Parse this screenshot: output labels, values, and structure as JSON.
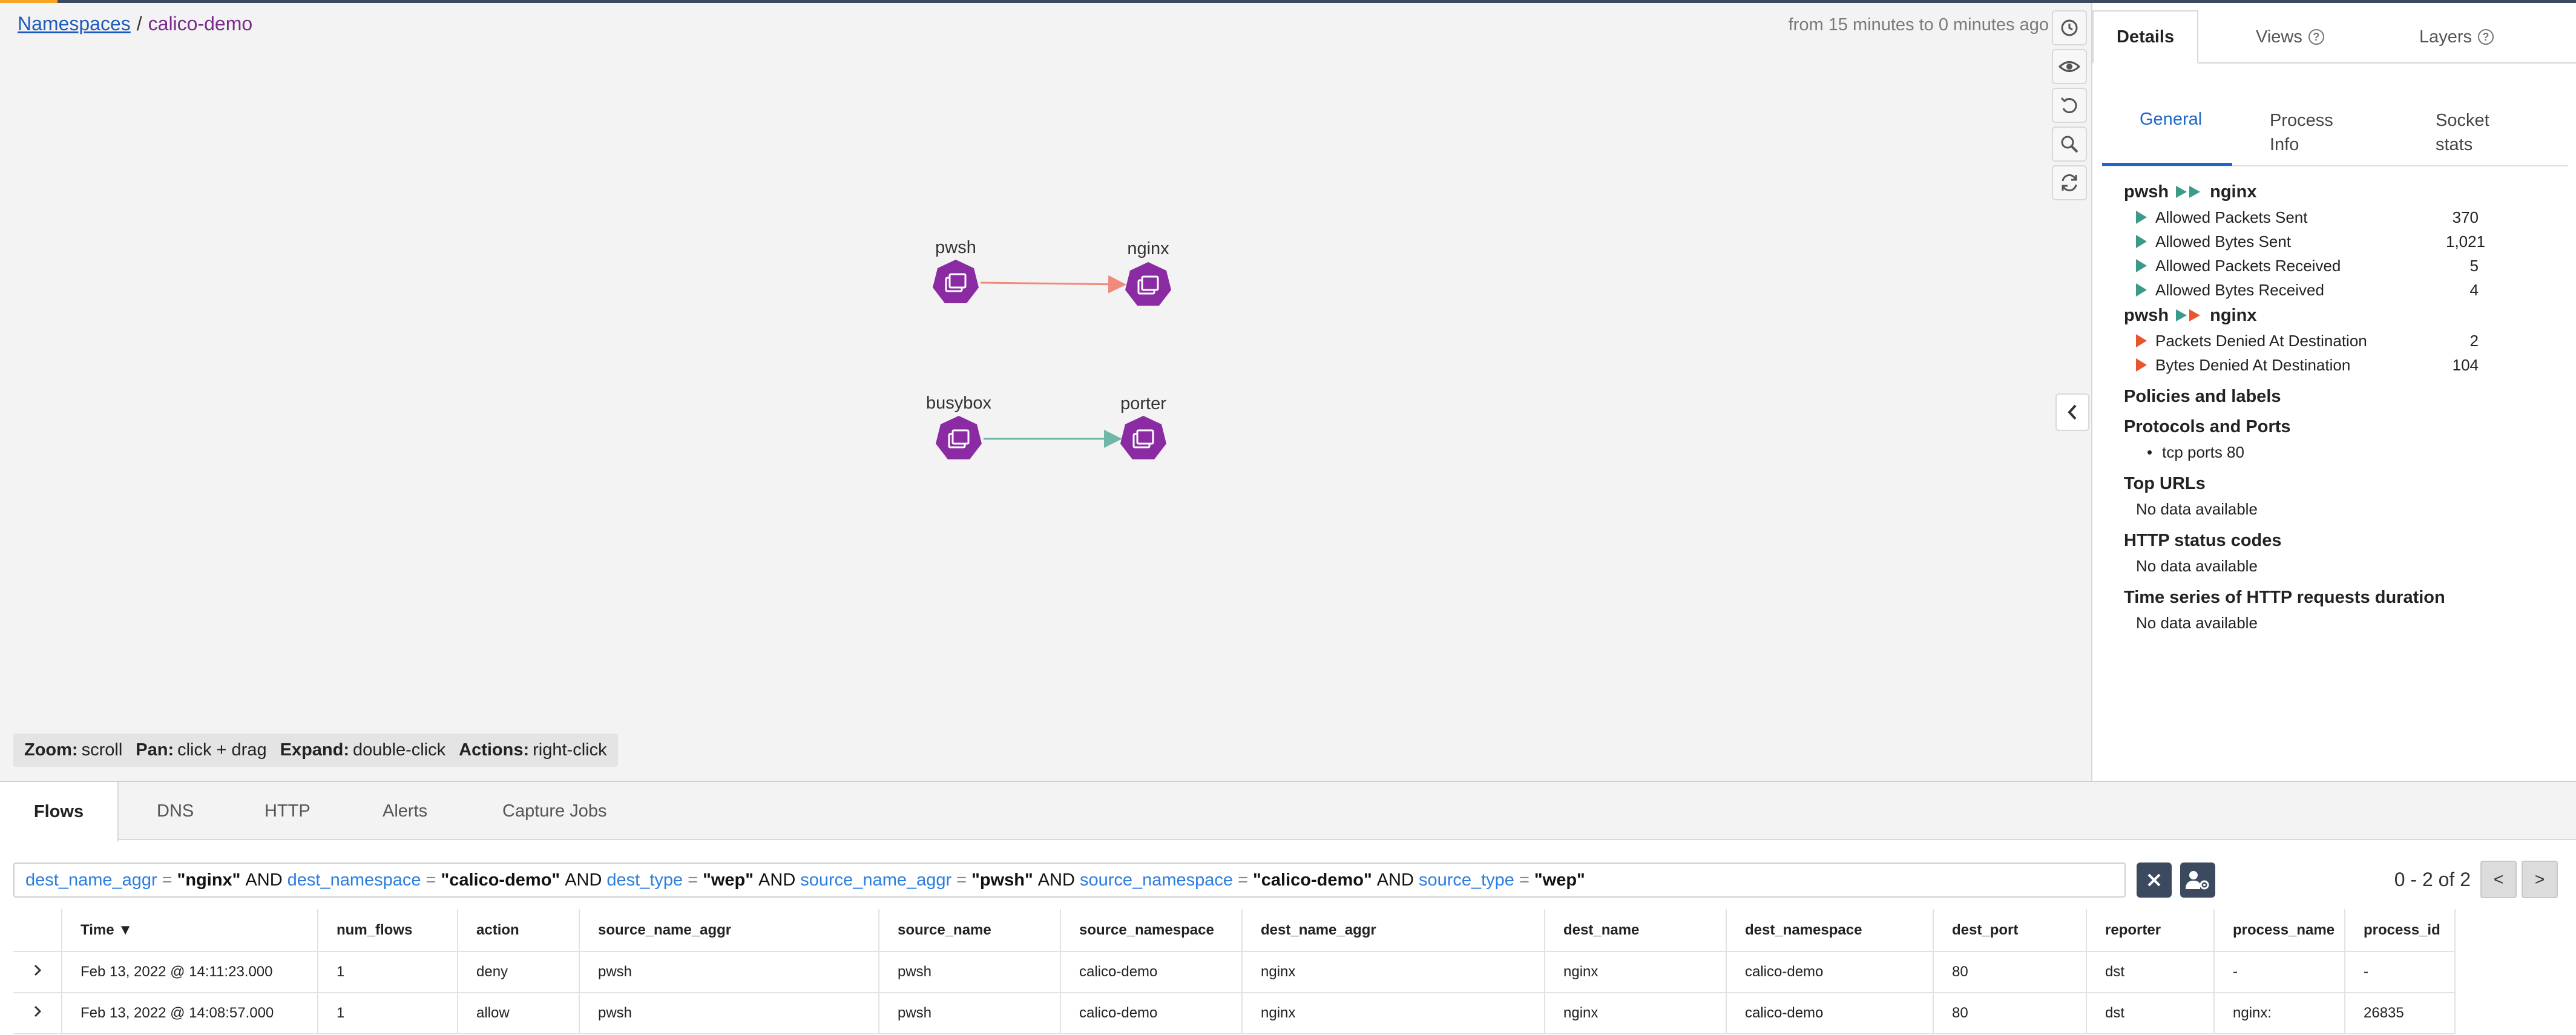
{
  "breadcrumb": {
    "root": "Namespaces",
    "separator": "/",
    "current": "calico-demo"
  },
  "time_range": "from 15 minutes to 0 minutes ago",
  "graph": {
    "nodes": [
      {
        "id": "pwsh",
        "label": "pwsh"
      },
      {
        "id": "nginx",
        "label": "nginx"
      },
      {
        "id": "busybox",
        "label": "busybox"
      },
      {
        "id": "porter",
        "label": "porter"
      }
    ],
    "edges": [
      {
        "from": "pwsh",
        "to": "nginx",
        "color": "#f08b7b"
      },
      {
        "from": "busybox",
        "to": "porter",
        "color": "#6fb8a8"
      }
    ],
    "node_color": "#8a2ba3"
  },
  "hints": [
    {
      "key": "Zoom:",
      "value": "scroll"
    },
    {
      "key": "Pan:",
      "value": "click + drag"
    },
    {
      "key": "Expand:",
      "value": "double-click"
    },
    {
      "key": "Actions:",
      "value": "right-click"
    }
  ],
  "right_panel": {
    "tabs": {
      "details": "Details",
      "views": "Views",
      "layers": "Layers"
    },
    "subtabs": {
      "general": "General",
      "process_info_1": "Process",
      "process_info_2": "Info",
      "socket_stats_1": "Socket",
      "socket_stats_2": "stats"
    },
    "allowed": {
      "source": "pwsh",
      "dest": "nginx",
      "stats": [
        {
          "name": "Allowed Packets Sent",
          "value": "370"
        },
        {
          "name": "Allowed Bytes Sent",
          "value": "1,021"
        },
        {
          "name": "Allowed Packets Received",
          "value": "5"
        },
        {
          "name": "Allowed Bytes Received",
          "value": "4"
        }
      ]
    },
    "denied": {
      "source": "pwsh",
      "dest": "nginx",
      "stats": [
        {
          "name": "Packets Denied At Destination",
          "value": "2"
        },
        {
          "name": "Bytes Denied At Destination",
          "value": "104"
        }
      ]
    },
    "policies_title": "Policies and labels",
    "protocols_title": "Protocols and Ports",
    "protocols_item": "tcp ports 80",
    "top_urls_title": "Top URLs",
    "http_codes_title": "HTTP status codes",
    "http_duration_title": "Time series of HTTP requests duration",
    "no_data": "No data available",
    "colors": {
      "allowed": "#3a9b8b",
      "denied": "#e8542e"
    }
  },
  "bottom_tabs": {
    "flows": "Flows",
    "dns": "DNS",
    "http": "HTTP",
    "alerts": "Alerts",
    "capture": "Capture Jobs"
  },
  "query": {
    "clauses": [
      {
        "field": "dest_name_aggr",
        "op": "=",
        "value": "\"nginx\""
      },
      {
        "field": "dest_namespace",
        "op": "=",
        "value": "\"calico-demo\""
      },
      {
        "field": "dest_type",
        "op": "=",
        "value": "\"wep\""
      },
      {
        "field": "source_name_aggr",
        "op": "=",
        "value": "\"pwsh\""
      },
      {
        "field": "source_namespace",
        "op": "=",
        "value": "\"calico-demo\""
      },
      {
        "field": "source_type",
        "op": "=",
        "value": "\"wep\""
      }
    ],
    "joiner": "AND"
  },
  "pager": {
    "text": "0 - 2 of 2",
    "prev": "<",
    "next": ">"
  },
  "table": {
    "columns": [
      "Time ▼",
      "num_flows",
      "action",
      "source_name_aggr",
      "source_name",
      "source_namespace",
      "dest_name_aggr",
      "dest_name",
      "dest_namespace",
      "dest_port",
      "reporter",
      "process_name",
      "process_id"
    ],
    "rows": [
      [
        "Feb 13, 2022 @ 14:11:23.000",
        "1",
        "deny",
        "pwsh",
        "pwsh",
        "calico-demo",
        "nginx",
        "nginx",
        "calico-demo",
        "80",
        "dst",
        "-",
        "-"
      ],
      [
        "Feb 13, 2022 @ 14:08:57.000",
        "1",
        "allow",
        "pwsh",
        "pwsh",
        "calico-demo",
        "nginx",
        "nginx",
        "calico-demo",
        "80",
        "dst",
        "nginx:",
        "26835"
      ]
    ]
  }
}
